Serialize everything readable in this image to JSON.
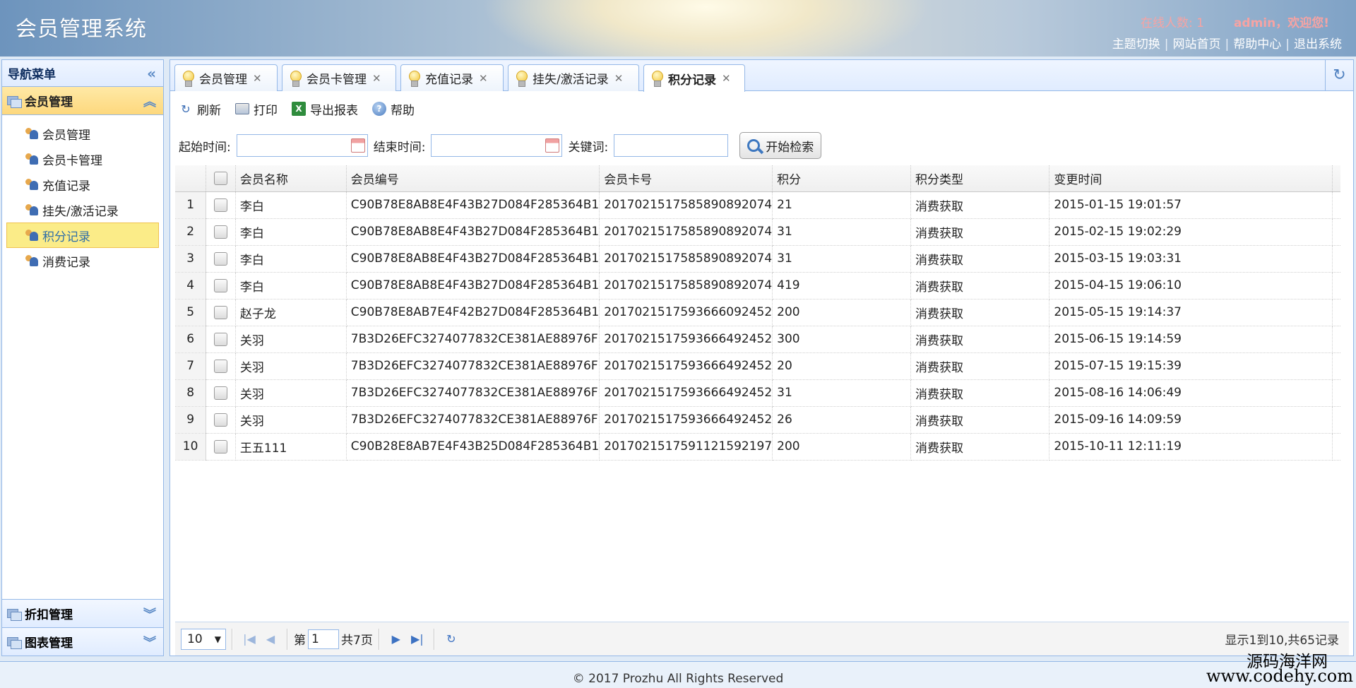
{
  "header": {
    "title": "会员管理系统",
    "online": "在线人数: 1",
    "welcome": "admin，欢迎您!",
    "links": [
      "主题切换",
      "网站首页",
      "帮助中心",
      "退出系统"
    ]
  },
  "sidebar": {
    "title": "导航菜单",
    "groups": [
      {
        "label": "会员管理",
        "expanded": true,
        "items": [
          "会员管理",
          "会员卡管理",
          "充值记录",
          "挂失/激活记录",
          "积分记录",
          "消费记录"
        ],
        "selected": "积分记录"
      },
      {
        "label": "折扣管理",
        "expanded": false
      },
      {
        "label": "图表管理",
        "expanded": false
      }
    ]
  },
  "tabs": [
    {
      "label": "会员管理",
      "active": false
    },
    {
      "label": "会员卡管理",
      "active": false
    },
    {
      "label": "充值记录",
      "active": false
    },
    {
      "label": "挂失/激活记录",
      "active": false
    },
    {
      "label": "积分记录",
      "active": true
    }
  ],
  "toolbar": {
    "refresh": "刷新",
    "print": "打印",
    "export": "导出报表",
    "help": "帮助"
  },
  "search": {
    "start_label": "起始时间:",
    "start_value": "",
    "end_label": "结束时间:",
    "end_value": "",
    "keyword_label": "关键词:",
    "keyword_value": "",
    "button": "开始检索"
  },
  "table": {
    "columns": [
      "会员名称",
      "会员编号",
      "会员卡号",
      "积分",
      "积分类型",
      "变更时间"
    ],
    "rows": [
      [
        "1",
        "李白",
        "C90B78E8AB8E4F43B27D084F285364B1",
        "20170215175858908920​74",
        "21",
        "消费获取",
        "2015-01-15 19:01:57"
      ],
      [
        "2",
        "李白",
        "C90B78E8AB8E4F43B27D084F285364B1",
        "2017021517585890892074",
        "31",
        "消费获取",
        "2015-02-15 19:02:29"
      ],
      [
        "3",
        "李白",
        "C90B78E8AB8E4F43B27D084F285364B1",
        "2017021517585890892074",
        "31",
        "消费获取",
        "2015-03-15 19:03:31"
      ],
      [
        "4",
        "李白",
        "C90B78E8AB8E4F43B27D084F285364B1",
        "2017021517585890892074",
        "419",
        "消费获取",
        "2015-04-15 19:06:10"
      ],
      [
        "5",
        "赵子龙",
        "C90B78E8AB7E4F42B27D084F285364B1",
        "2017021517593666092452",
        "200",
        "消费获取",
        "2015-05-15 19:14:37"
      ],
      [
        "6",
        "关羽",
        "7B3D26EFC3274077832CE381AE88976F",
        "2017021517593666492452",
        "300",
        "消费获取",
        "2015-06-15 19:14:59"
      ],
      [
        "7",
        "关羽",
        "7B3D26EFC3274077832CE381AE88976F",
        "2017021517593666492452",
        "20",
        "消费获取",
        "2015-07-15 19:15:39"
      ],
      [
        "8",
        "关羽",
        "7B3D26EFC3274077832CE381AE88976F",
        "2017021517593666492452",
        "31",
        "消费获取",
        "2015-08-16 14:06:49"
      ],
      [
        "9",
        "关羽",
        "7B3D26EFC3274077832CE381AE88976F",
        "2017021517593666492452",
        "26",
        "消费获取",
        "2015-09-16 14:09:59"
      ],
      [
        "10",
        "王五111",
        "C90B28E8AB7E4F43B25D084F285364B1",
        "2017021517591121592197",
        "200",
        "消费获取",
        "2015-10-11 12:11:19"
      ]
    ]
  },
  "pager": {
    "page_size": "10",
    "page_prefix": "第",
    "page_value": "1",
    "page_suffix": "共7页",
    "info": "显示1到10,共65记录"
  },
  "footer": {
    "copyright": "© 2017 Prozhu All Rights Reserved",
    "watermark_cn": "源码海洋网",
    "watermark_url": "www.codehy.com"
  }
}
